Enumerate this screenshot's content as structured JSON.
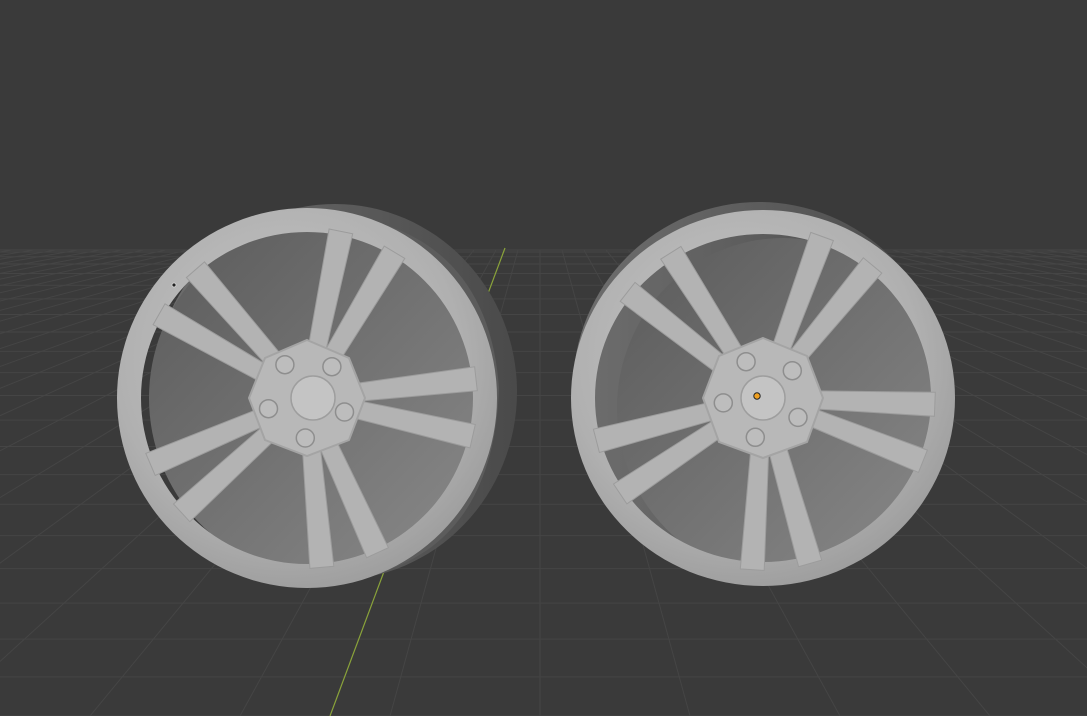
{
  "viewport": {
    "background_color": "#3a3a3a",
    "grid_color": "#454545",
    "x_axis_color": "#9c3b3b",
    "y_axis_color": "#8aa33a"
  },
  "scene": {
    "objects": [
      {
        "kind": "wheel-rim",
        "spoke_count": 10,
        "lug_count": 5,
        "selected": false
      },
      {
        "kind": "wheel-rim",
        "spoke_count": 10,
        "lug_count": 5,
        "selected": true
      }
    ],
    "mesh_color": "#b3b3b3",
    "origin_color": "#f0a020"
  }
}
